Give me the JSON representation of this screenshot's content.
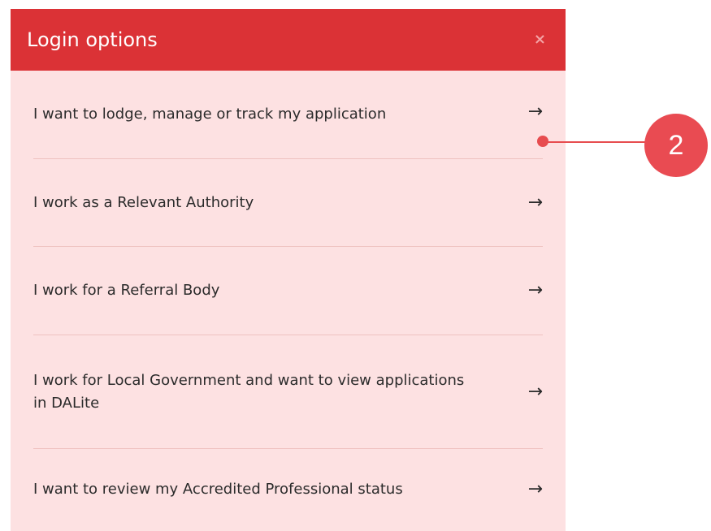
{
  "dialog": {
    "title": "Login options",
    "close_icon": "×",
    "options": [
      {
        "label": "I want to lodge, manage or track my application",
        "arrow": "→"
      },
      {
        "label": "I work as a Relevant Authority",
        "arrow": "→"
      },
      {
        "label": "I work for a Referral Body",
        "arrow": "→"
      },
      {
        "label": "I work for Local Government and want to view applications in DALite",
        "arrow": "→"
      },
      {
        "label": "I want to review my Accredited Professional status",
        "arrow": "→"
      }
    ]
  },
  "callout": {
    "number": "2",
    "color": "#e94b52"
  },
  "colors": {
    "header": "#db3236",
    "panel_bg": "#fde1e2"
  }
}
